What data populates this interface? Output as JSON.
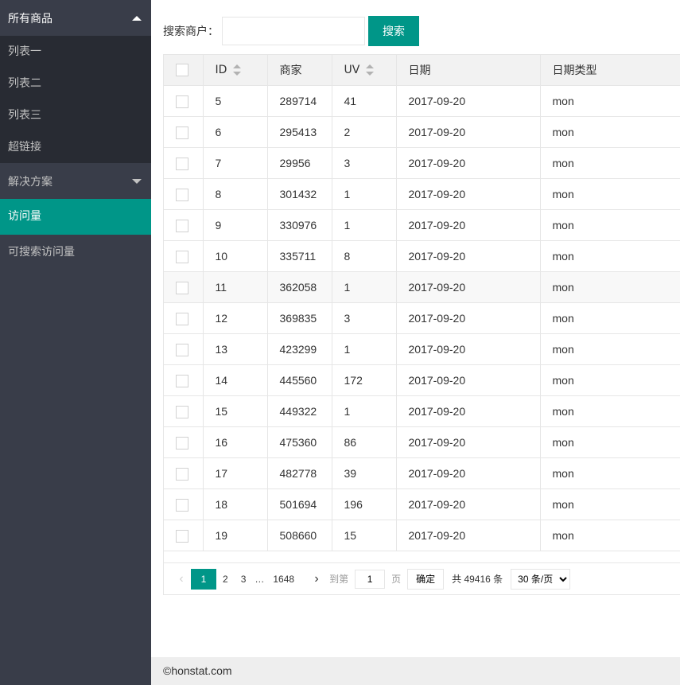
{
  "sidebar": {
    "group1": {
      "title": "所有商品",
      "items": [
        {
          "label": "列表一"
        },
        {
          "label": "列表二"
        },
        {
          "label": "列表三"
        },
        {
          "label": "超链接"
        }
      ]
    },
    "group2": {
      "title": "解决方案"
    },
    "active_item": "访问量",
    "item_searchable": "可搜索访问量"
  },
  "search": {
    "label": "搜索商户：",
    "value": "",
    "placeholder": "",
    "button": "搜索"
  },
  "table": {
    "headers": [
      "ID",
      "商家",
      "UV",
      "日期",
      "日期类型"
    ],
    "rows": [
      {
        "id": "5",
        "merchant": "289714",
        "uv": "41",
        "date": "2017-09-20",
        "type": "mon"
      },
      {
        "id": "6",
        "merchant": "295413",
        "uv": "2",
        "date": "2017-09-20",
        "type": "mon"
      },
      {
        "id": "7",
        "merchant": "29956",
        "uv": "3",
        "date": "2017-09-20",
        "type": "mon"
      },
      {
        "id": "8",
        "merchant": "301432",
        "uv": "1",
        "date": "2017-09-20",
        "type": "mon"
      },
      {
        "id": "9",
        "merchant": "330976",
        "uv": "1",
        "date": "2017-09-20",
        "type": "mon"
      },
      {
        "id": "10",
        "merchant": "335711",
        "uv": "8",
        "date": "2017-09-20",
        "type": "mon"
      },
      {
        "id": "11",
        "merchant": "362058",
        "uv": "1",
        "date": "2017-09-20",
        "type": "mon"
      },
      {
        "id": "12",
        "merchant": "369835",
        "uv": "3",
        "date": "2017-09-20",
        "type": "mon"
      },
      {
        "id": "13",
        "merchant": "423299",
        "uv": "1",
        "date": "2017-09-20",
        "type": "mon"
      },
      {
        "id": "14",
        "merchant": "445560",
        "uv": "172",
        "date": "2017-09-20",
        "type": "mon"
      },
      {
        "id": "15",
        "merchant": "449322",
        "uv": "1",
        "date": "2017-09-20",
        "type": "mon"
      },
      {
        "id": "16",
        "merchant": "475360",
        "uv": "86",
        "date": "2017-09-20",
        "type": "mon"
      },
      {
        "id": "17",
        "merchant": "482778",
        "uv": "39",
        "date": "2017-09-20",
        "type": "mon"
      },
      {
        "id": "18",
        "merchant": "501694",
        "uv": "196",
        "date": "2017-09-20",
        "type": "mon"
      },
      {
        "id": "19",
        "merchant": "508660",
        "uv": "15",
        "date": "2017-09-20",
        "type": "mon"
      }
    ]
  },
  "pager": {
    "pages": [
      "1",
      "2",
      "3"
    ],
    "ellipsis": "…",
    "last_page": "1648",
    "goto_label": "到第",
    "goto_value": "1",
    "page_unit": "页",
    "confirm": "确定",
    "total": "共 49416 条",
    "page_size": "30 条/页"
  },
  "footer": {
    "text": "©honstat.com"
  },
  "colors": {
    "accent": "#009688",
    "sidebar_bg": "#393d49",
    "sidebar_sub_bg": "#282b33"
  }
}
